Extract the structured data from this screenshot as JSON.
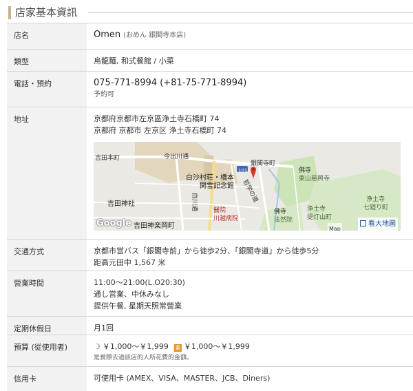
{
  "section": {
    "title": "店家基本資訊"
  },
  "rows": {
    "name": {
      "label": "店名",
      "value": "Omen",
      "kana": "(おめん 銀閣寺本店)"
    },
    "type": {
      "label": "類型",
      "value": "烏龍麵, 和式餐館 / 小菜"
    },
    "tel": {
      "label": "電話・預約",
      "value": "075-771-8994 (+81-75-771-8994)",
      "note": "予約可"
    },
    "address": {
      "label": "地址",
      "line1": "京都府京都市左京區浄土寺石橋町 74",
      "line2": "京都府 京都市 左京区 浄土寺石橋町 74",
      "map": {
        "labels": {
          "yoshida_honmachi": "吉田本町",
          "imadegawa": "今出川通",
          "route101": "101",
          "ginkakuji_machi": "銀閣寺町",
          "hakusason": "白沙村荘・橋本",
          "kansetsu": "関雪記念館",
          "tetsugaku": "哲学の道",
          "temple1": "佛寺",
          "higashiyama": "東山慈照寺",
          "shirakawa": "白川通",
          "yoshida_jinja": "吉田神社",
          "hospital": "醫院",
          "kawasaki": "川越病院",
          "hosenin": "法然院",
          "temple2": "佛寺",
          "jodoji": "浄土寺",
          "jodoji_teitou": "提灯山町",
          "jodoji2": "浄土寺",
          "nanamagari": "七廻り町",
          "yoshida_kaguraoka": "吉田神楽岡町"
        },
        "google": "Google",
        "mapdata": "Map",
        "bigmap": "看大地圖"
      }
    },
    "transport": {
      "label": "交通方式",
      "line1": "京都市営バス「銀閣寺前」から徒歩2分、「銀閣寺道」から徒歩5分",
      "line2": "距高元田中 1,567 米"
    },
    "hours": {
      "label": "營業時間",
      "line1": "11:00～21:00(L.O20:30)",
      "line2": "通し営業、中休みなし",
      "line3": "提供午餐, 星期天照常營業"
    },
    "holiday": {
      "label": "定期休假日",
      "value": "月1回"
    },
    "budget": {
      "label": "預算 (從使用者)",
      "dinner": "￥1,000～￥1,999",
      "lunch": "￥1,000～￥1,999",
      "lunch_icon": "晝",
      "note": "是實際去過該店的人所花費的金額。"
    },
    "card": {
      "label": "信用卡",
      "value": "可使用卡 (AMEX、VISA、MASTER、JCB、Diners)"
    }
  },
  "colors": {
    "accent_bar": "#c8b48c",
    "map_pin": "#d83a2e",
    "link": "#1a4fa0"
  }
}
